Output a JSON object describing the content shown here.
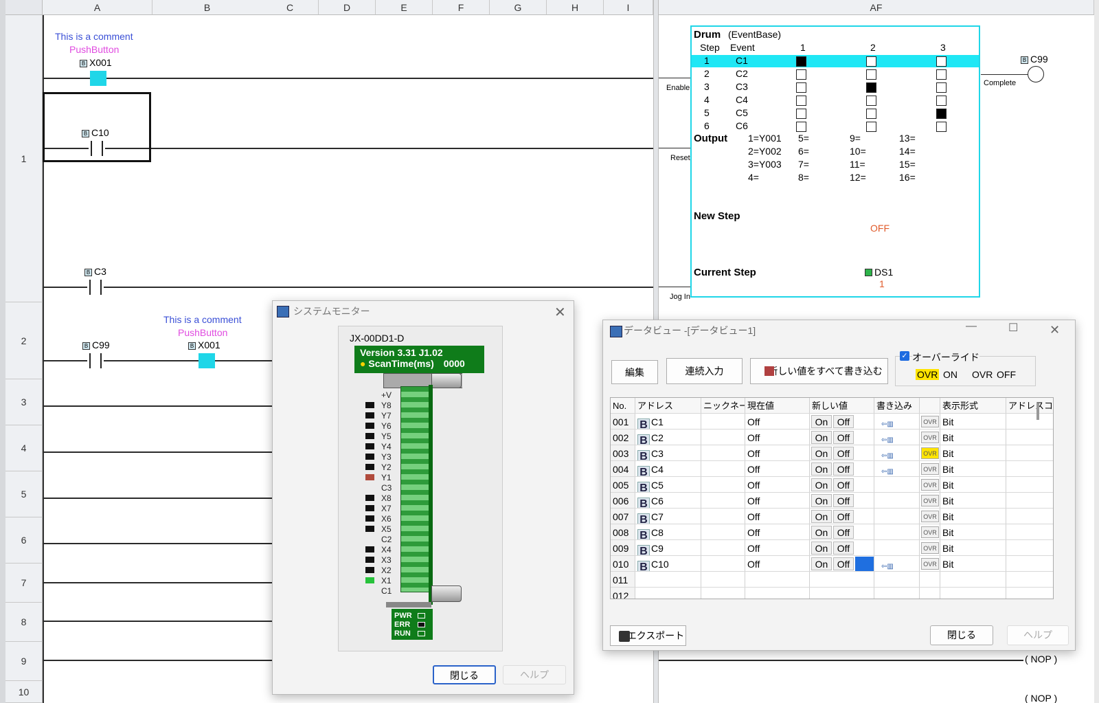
{
  "columns": [
    "A",
    "B",
    "C",
    "D",
    "E",
    "F",
    "G",
    "H",
    "I",
    "AF"
  ],
  "rows": [
    "1",
    "2",
    "3",
    "4",
    "5",
    "6",
    "7",
    "8",
    "9",
    "10"
  ],
  "ladder": {
    "r1_comment": "This is a comment",
    "r1_comment2": "PushButton",
    "r1_x001": "X001",
    "r1_c10": "C10",
    "r1_c3": "C3",
    "r2_c99": "C99",
    "r2_comment": "This is a comment",
    "r2_comment2": "PushButton",
    "r2_x001": "X001",
    "coil_c99": "C99",
    "enable": "Enable",
    "reset": "Reset",
    "jog": "Jog In",
    "complete": "Complete",
    "nop1": "( NOP )",
    "nop2": "( NOP )"
  },
  "drum": {
    "title": "Drum",
    "base": "(EventBase)",
    "step_hdr": "Step",
    "event_hdr": "Event",
    "col1": "1",
    "col2": "2",
    "col3": "3",
    "steps": [
      {
        "n": "1",
        "e": "C1",
        "c": [
          true,
          false,
          false
        ]
      },
      {
        "n": "2",
        "e": "C2",
        "c": [
          false,
          false,
          false
        ]
      },
      {
        "n": "3",
        "e": "C3",
        "c": [
          false,
          true,
          false
        ]
      },
      {
        "n": "4",
        "e": "C4",
        "c": [
          false,
          false,
          false
        ]
      },
      {
        "n": "5",
        "e": "C5",
        "c": [
          false,
          false,
          true
        ]
      },
      {
        "n": "6",
        "e": "C6",
        "c": [
          false,
          false,
          false
        ]
      }
    ],
    "output_label": "Output",
    "outputs": [
      [
        "1=Y001",
        "5=",
        "9=",
        "13="
      ],
      [
        "2=Y002",
        "6=",
        "10=",
        "14="
      ],
      [
        "3=Y003",
        "7=",
        "11=",
        "15="
      ],
      [
        "4=",
        "8=",
        "12=",
        "16="
      ]
    ],
    "new_step_label": "New Step",
    "new_step_value": "OFF",
    "current_step_label": "Current Step",
    "current_step_addr": "DS1",
    "current_step_value": "1"
  },
  "sysmon": {
    "title": "システムモニター",
    "model": "JX-00DD1-D",
    "version": "Version 3.31 J1.02",
    "scan": "ScanTime(ms)",
    "scan_value": "0000",
    "labels": [
      "+V",
      "Y8",
      "Y7",
      "Y6",
      "Y5",
      "Y4",
      "Y3",
      "Y2",
      "Y1",
      "C3",
      "X8",
      "X7",
      "X6",
      "X5",
      "C2",
      "X4",
      "X3",
      "X2",
      "X1",
      "C1"
    ],
    "status": [
      "PWR",
      "ERR",
      "RUN"
    ],
    "close": "閉じる",
    "help": "ヘルプ"
  },
  "dataview": {
    "title": "データビュー -[データビュー1]",
    "edit": "編集",
    "continuous": "連続入力",
    "write_all": "新しい値をすべて書き込む",
    "override": "オーバーライド",
    "ovr_on_tag": "OVR",
    "ovr_on": "ON",
    "ovr_off_tag": "OVR",
    "ovr_off": "OFF",
    "headers": [
      "No.",
      "アドレス",
      "ニックネーム",
      "現在値",
      "新しい値",
      "書き込み",
      "",
      "表示形式",
      "アドレスコ"
    ],
    "rows": [
      {
        "no": "001",
        "addr": "C1",
        "cur": "Off",
        "write": true,
        "ovr": false,
        "fmt": "Bit"
      },
      {
        "no": "002",
        "addr": "C2",
        "cur": "Off",
        "write": true,
        "ovr": false,
        "fmt": "Bit"
      },
      {
        "no": "003",
        "addr": "C3",
        "cur": "Off",
        "write": true,
        "ovr": true,
        "fmt": "Bit"
      },
      {
        "no": "004",
        "addr": "C4",
        "cur": "Off",
        "write": true,
        "ovr": false,
        "fmt": "Bit"
      },
      {
        "no": "005",
        "addr": "C5",
        "cur": "Off",
        "write": false,
        "ovr": false,
        "fmt": "Bit"
      },
      {
        "no": "006",
        "addr": "C6",
        "cur": "Off",
        "write": false,
        "ovr": false,
        "fmt": "Bit"
      },
      {
        "no": "007",
        "addr": "C7",
        "cur": "Off",
        "write": false,
        "ovr": false,
        "fmt": "Bit"
      },
      {
        "no": "008",
        "addr": "C8",
        "cur": "Off",
        "write": false,
        "ovr": false,
        "fmt": "Bit"
      },
      {
        "no": "009",
        "addr": "C9",
        "cur": "Off",
        "write": false,
        "ovr": false,
        "fmt": "Bit"
      },
      {
        "no": "010",
        "addr": "C10",
        "cur": "Off",
        "write": true,
        "ovr": false,
        "fmt": "Bit"
      },
      {
        "no": "011"
      },
      {
        "no": "012"
      }
    ],
    "on": "On",
    "off": "Off",
    "ovr": "OVR",
    "b": "B",
    "export": "エクスポート",
    "close": "閉じる",
    "help": "ヘルプ"
  }
}
